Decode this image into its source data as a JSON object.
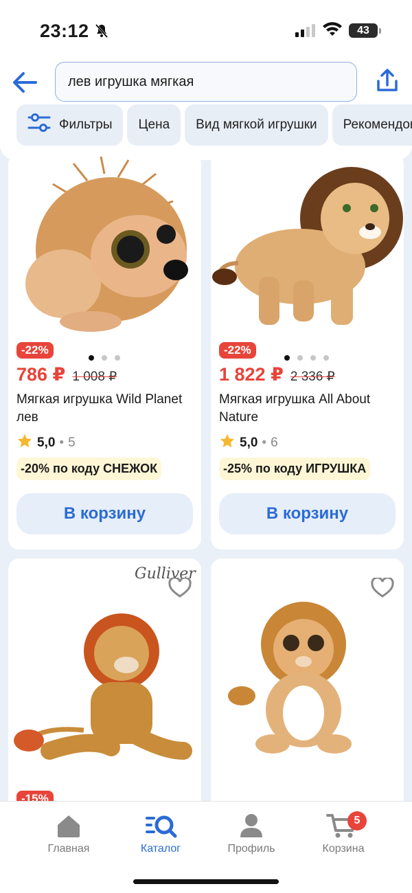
{
  "status_bar": {
    "time": "23:12",
    "battery": "43"
  },
  "header": {
    "search_value": "лев игрушка мягкая",
    "chips": [
      "Фильтры",
      "Цена",
      "Вид мягкой игрушки",
      "Рекомендова"
    ]
  },
  "products": [
    {
      "discount": "-22%",
      "price": "786 ₽",
      "old_price": "1 008 ₽",
      "title": "Мягкая игрушка Wild Planet лев",
      "rating": "5,0",
      "reviews": "5",
      "promo": "-20% по коду СНЕЖОК",
      "button": "В корзину"
    },
    {
      "discount": "-22%",
      "price": "1 822 ₽",
      "old_price": "2 336 ₽",
      "title": "Мягкая игрушка All About Nature",
      "rating": "5,0",
      "reviews": "6",
      "promo": "-25% по коду ИГРУШКА",
      "button": "В корзину"
    },
    {
      "brand": "Gulliver",
      "discount": "-15%"
    },
    {}
  ],
  "nav": {
    "items": [
      "Главная",
      "Каталог",
      "Профиль",
      "Корзина"
    ],
    "cart_count": "5"
  },
  "colors": {
    "accent": "#2b6bd6",
    "sale": "#e8443a",
    "promo_bg": "#fff6d6"
  }
}
